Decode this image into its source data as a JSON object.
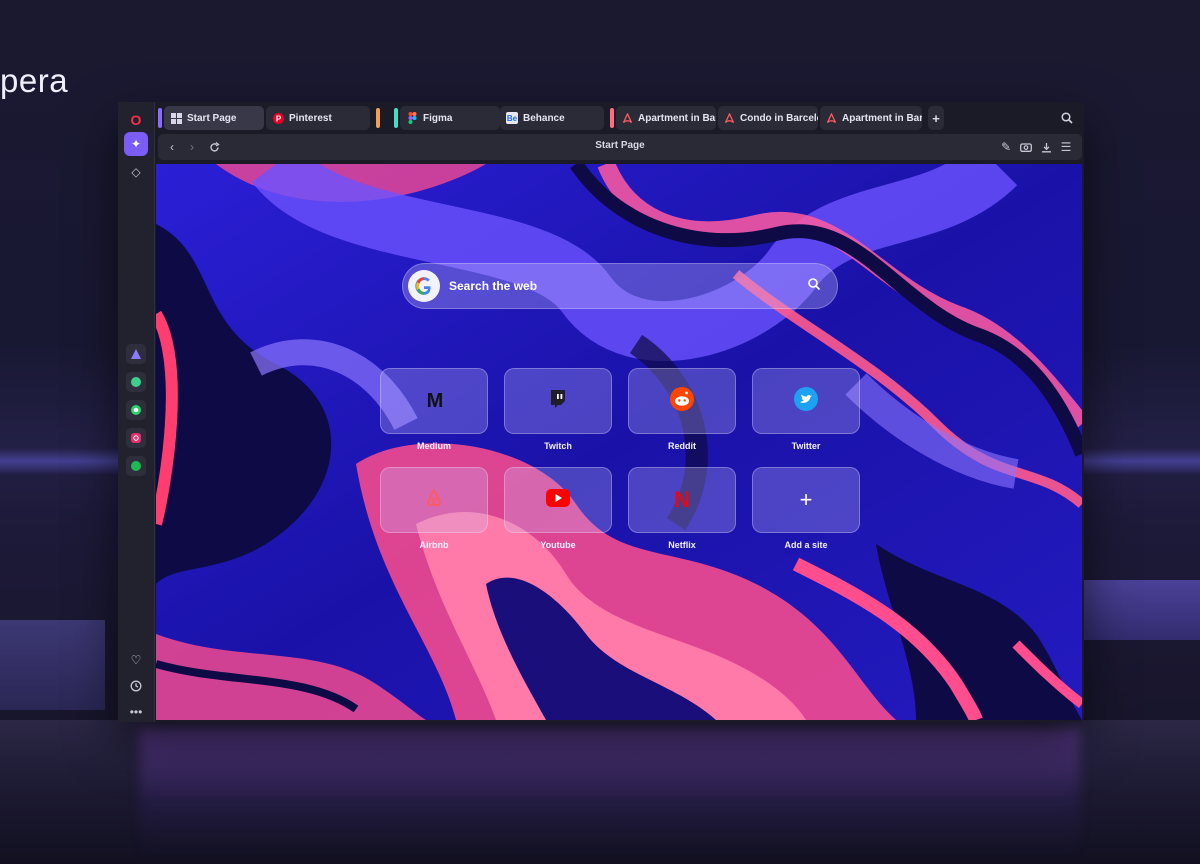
{
  "brand": {
    "name": "pera"
  },
  "window": {
    "tabs": [
      {
        "label": "Start Page",
        "icon": "speed-dial-icon",
        "active": true
      },
      {
        "label": "Pinterest",
        "icon": "pinterest-icon"
      },
      {
        "label": "Figma",
        "icon": "figma-icon"
      },
      {
        "label": "Behance",
        "icon": "behance-icon",
        "icon_text": "Be"
      },
      {
        "label": "Apartment in Bar",
        "icon": "airbnb-icon"
      },
      {
        "label": "Condo in Barcelo",
        "icon": "airbnb-icon"
      },
      {
        "label": "Apartment in Bar",
        "icon": "airbnb-icon"
      }
    ],
    "toolbar": {
      "address": "Start Page"
    }
  },
  "start_page": {
    "search": {
      "placeholder": "Search the web"
    },
    "speed_dial": [
      {
        "label": "Medium",
        "icon": "medium-icon",
        "icon_text": "M"
      },
      {
        "label": "Twitch",
        "icon": "twitch-icon"
      },
      {
        "label": "Reddit",
        "icon": "reddit-icon"
      },
      {
        "label": "Twitter",
        "icon": "twitter-icon"
      },
      {
        "label": "Airbnb",
        "icon": "airbnb-icon"
      },
      {
        "label": "Youtube",
        "icon": "youtube-icon"
      },
      {
        "label": "Netflix",
        "icon": "netflix-icon",
        "icon_text": "N"
      },
      {
        "label": "Add a site",
        "icon": "plus-icon",
        "icon_text": "+"
      }
    ]
  },
  "colors": {
    "accent": "#7b5cf5",
    "opera_red": "#ff2d4a",
    "wallpaper_blue": "#2a1fd0",
    "wallpaper_pink": "#ff4d8d"
  }
}
